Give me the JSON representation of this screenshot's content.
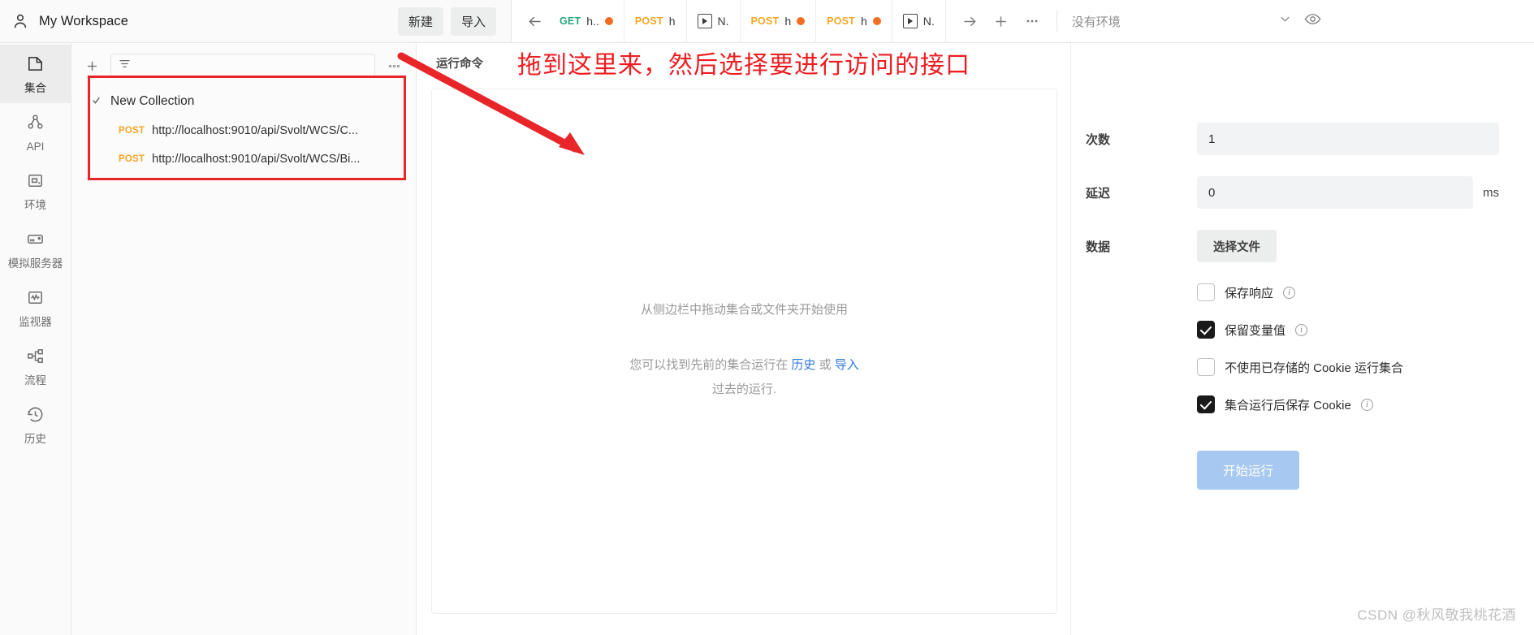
{
  "workspace": {
    "user_icon": "person-icon",
    "title": "My Workspace",
    "new_label": "新建",
    "import_label": "导入"
  },
  "tabs": {
    "back_icon": "arrow-left-icon",
    "items": [
      {
        "method": "GET",
        "method_class": "get",
        "name": "h..",
        "dirty": true,
        "type": "request"
      },
      {
        "method": "POST",
        "method_class": "post",
        "name": "h",
        "dirty": false,
        "type": "request"
      },
      {
        "method": "",
        "method_class": "",
        "name": "N.",
        "dirty": false,
        "type": "runner"
      },
      {
        "method": "POST",
        "method_class": "post",
        "name": "h",
        "dirty": true,
        "type": "request"
      },
      {
        "method": "POST",
        "method_class": "post",
        "name": "h",
        "dirty": true,
        "type": "request"
      },
      {
        "method": "",
        "method_class": "",
        "name": "N.",
        "dirty": false,
        "type": "runner"
      }
    ],
    "forward_icon": "arrow-right-icon",
    "new_tab_icon": "plus-icon",
    "more_icon": "ellipsis-icon"
  },
  "environment": {
    "selected": "没有环境",
    "chevron_icon": "chevron-down-icon",
    "eye_icon": "eye-icon"
  },
  "rail": {
    "items": [
      {
        "label": "集合",
        "icon": "collection-icon",
        "active": true
      },
      {
        "label": "API",
        "icon": "api-icon",
        "active": false
      },
      {
        "label": "环境",
        "icon": "environment-icon",
        "active": false
      },
      {
        "label": "模拟服务器",
        "icon": "mock-server-icon",
        "active": false
      },
      {
        "label": "监视器",
        "icon": "monitor-icon",
        "active": false
      },
      {
        "label": "流程",
        "icon": "flow-icon",
        "active": false
      },
      {
        "label": "历史",
        "icon": "history-icon",
        "active": false
      }
    ]
  },
  "collections": {
    "add_icon": "plus-icon",
    "filter_icon": "filter-icon",
    "filter_placeholder": "",
    "more_icon": "ellipsis-icon",
    "tree": {
      "chevron_icon": "chevron-down-icon",
      "name": "New Collection",
      "requests": [
        {
          "method": "POST",
          "url": "http://localhost:9010/api/Svolt/WCS/C..."
        },
        {
          "method": "POST",
          "url": "http://localhost:9010/api/Svolt/WCS/Bi..."
        }
      ]
    },
    "highlight_color": "#e8262a"
  },
  "runner": {
    "header_title": "运行命令",
    "drop_hint": "从侧边栏中拖动集合或文件夹开始使用",
    "history_prefix": "您可以找到先前的集合运行在",
    "history_link": "历史",
    "history_or": "或",
    "import_link": "导入",
    "history_suffix": "过去的运行.",
    "settings": {
      "iterations_label": "次数",
      "iterations_value": "1",
      "delay_label": "延迟",
      "delay_value": "0",
      "delay_unit": "ms",
      "data_label": "数据",
      "select_file_label": "选择文件",
      "checkboxes": [
        {
          "label": "保存响应",
          "checked": false,
          "info": true
        },
        {
          "label": "保留变量值",
          "checked": true,
          "info": true
        },
        {
          "label": "不使用已存储的 Cookie 运行集合",
          "checked": false,
          "info": false
        },
        {
          "label": "集合运行后保存 Cookie",
          "checked": true,
          "info": true
        }
      ],
      "run_button_label": "开始运行",
      "run_button_color": "#a7c8f0"
    }
  },
  "annotation": {
    "text": "拖到这里来，然后选择要进行访问的接口",
    "color": "#ef1c20",
    "arrow_name": "red-arrow"
  },
  "watermark": "CSDN @秋风敬我桃花酒"
}
